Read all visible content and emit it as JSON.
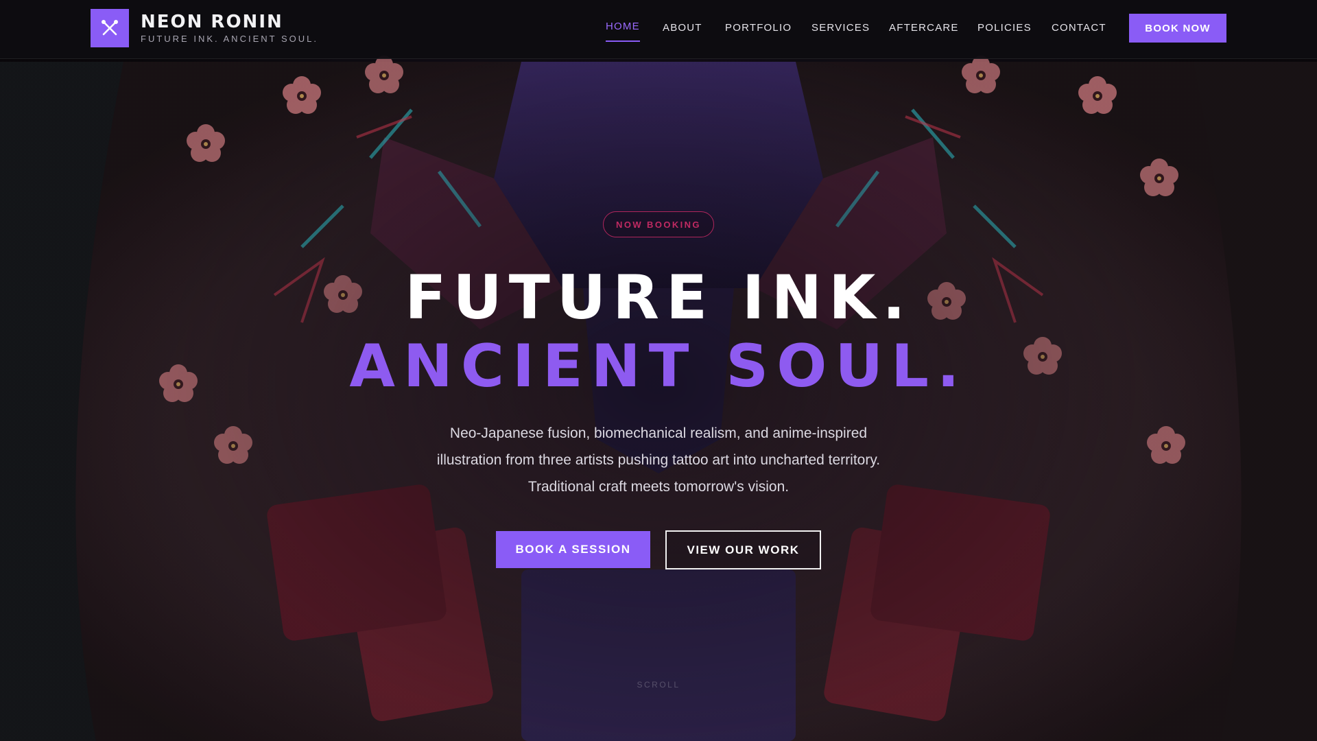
{
  "brand": {
    "name": "NEON RONIN",
    "tagline": "FUTURE INK. ANCIENT SOUL.",
    "logo_icon": "crossed-tools-icon"
  },
  "nav": {
    "items": [
      {
        "label": "HOME",
        "active": true
      },
      {
        "label": "ABOUT",
        "active": false
      },
      {
        "label": "PORTFOLIO",
        "active": false
      },
      {
        "label": "SERVICES",
        "active": false
      },
      {
        "label": "AFTERCARE",
        "active": false
      },
      {
        "label": "POLICIES",
        "active": false
      },
      {
        "label": "CONTACT",
        "active": false
      }
    ],
    "cta_label": "BOOK NOW"
  },
  "hero": {
    "badge": "NOW BOOKING",
    "headline_line1": "FUTURE INK.",
    "headline_line2": "ANCIENT SOUL.",
    "subtext": [
      "Neo-Japanese fusion, biomechanical realism, and anime-inspired",
      "illustration from three artists pushing tattoo art into uncharted territory.",
      "Traditional craft meets tomorrow's vision."
    ],
    "primary_button": "BOOK A SESSION",
    "secondary_button": "VIEW OUR WORK",
    "scroll_hint": "SCROLL"
  },
  "colors": {
    "accent": "#8a5cf6",
    "badge": "#c02a62",
    "background": "#0b0a0d",
    "text": "#ffffff"
  }
}
